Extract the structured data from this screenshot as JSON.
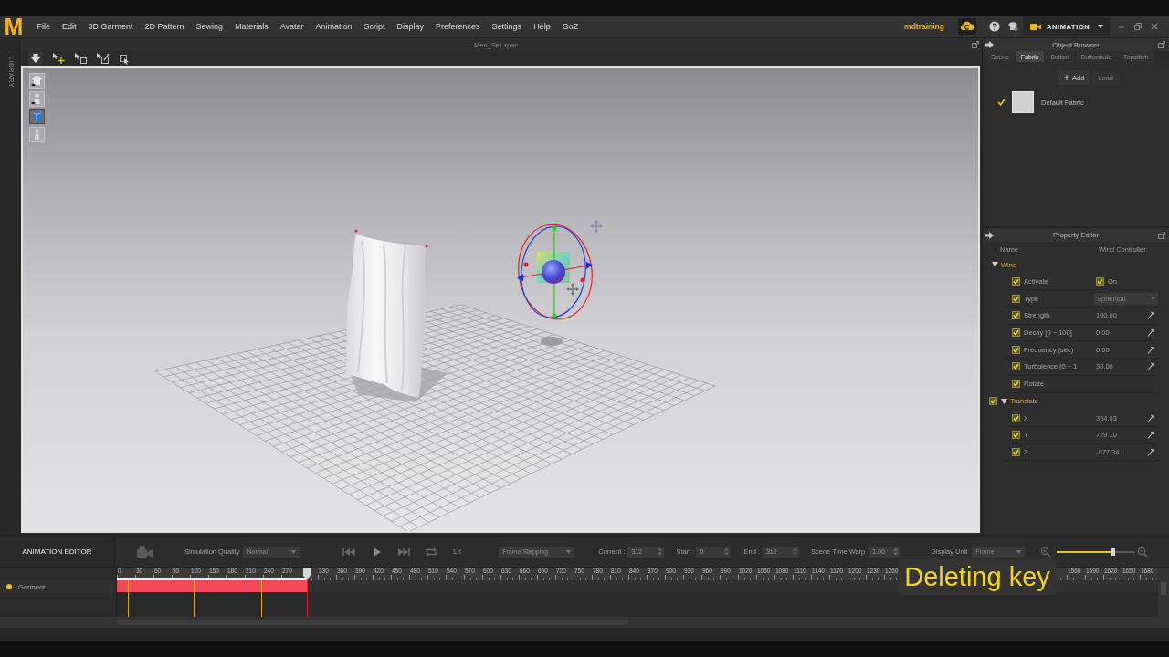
{
  "menu_bar": {
    "logo": "M",
    "items": [
      "File",
      "Edit",
      "3D Garment",
      "2D Pattern",
      "Sewing",
      "Materials",
      "Avatar",
      "Animation",
      "Script",
      "Display",
      "Preferences",
      "Settings",
      "Help",
      "GoZ"
    ],
    "user": "mdtraining",
    "mode": "ANIMATION"
  },
  "library": {
    "label": "LIBRARY"
  },
  "document": {
    "title": "Men_Set.zpac"
  },
  "viewport_tools": [
    {
      "kind": "garment",
      "selected": false
    },
    {
      "kind": "avatar",
      "selected": false
    },
    {
      "kind": "cube",
      "selected": true
    },
    {
      "kind": "figure",
      "selected": false
    }
  ],
  "object_browser": {
    "title": "Object Browser",
    "tabs": [
      {
        "label": "Scene",
        "selected": false
      },
      {
        "label": "Fabric",
        "selected": true
      },
      {
        "label": "Button",
        "selected": false
      },
      {
        "label": "Buttonhole",
        "selected": false
      },
      {
        "label": "Topstitch",
        "selected": false
      }
    ],
    "actions": [
      {
        "label": "Add",
        "disabled": false
      },
      {
        "label": "Load",
        "disabled": true
      }
    ],
    "fabrics": [
      {
        "name": "Default Fabric",
        "checked": true
      }
    ]
  },
  "property_editor": {
    "title": "Property Editor",
    "columns": [
      "Name",
      "Wind Controller"
    ],
    "groups": [
      {
        "kind": "heading",
        "label": "Wind",
        "expanded": true,
        "children": [
          {
            "kind": "toggle",
            "label": "Activate",
            "checked": true,
            "value": "On",
            "value_checked": true
          },
          {
            "kind": "dropdown",
            "label": "Type",
            "checked": true,
            "value": "Spherical"
          },
          {
            "kind": "number",
            "label": "Strength",
            "checked": true,
            "value": "100.00"
          },
          {
            "kind": "number",
            "label": "Decay [0 ~ 100]",
            "checked": true,
            "value": "0.00"
          },
          {
            "kind": "number",
            "label": "Frequency (sec)",
            "checked": true,
            "value": "0.00"
          },
          {
            "kind": "number",
            "label": "Turbulence [0 ~ 1",
            "checked": true,
            "value": "30.00"
          },
          {
            "kind": "plain",
            "label": "Rotate",
            "checked": true
          }
        ]
      },
      {
        "kind": "checkable-heading",
        "label": "Translate",
        "checked": true,
        "expanded": true,
        "children": [
          {
            "kind": "number",
            "label": "X",
            "checked": true,
            "value": "354.93"
          },
          {
            "kind": "number",
            "label": "Y",
            "checked": true,
            "value": "729.10"
          },
          {
            "kind": "number",
            "label": "Z",
            "checked": true,
            "value": "-977.34"
          }
        ]
      }
    ]
  },
  "animation_editor": {
    "title": "ANIMATION EDITOR",
    "simulation_quality": {
      "label": "Simulation Quality",
      "value": "Normal"
    },
    "speed": "1X",
    "stepping": "Frame Stepping",
    "fields": [
      {
        "label": "Current :",
        "value": "312"
      },
      {
        "label": "Start :",
        "value": "0"
      },
      {
        "label": "End :",
        "value": "312"
      },
      {
        "label": "Scene Time Warp",
        "value": "1.00"
      }
    ],
    "display_unit": {
      "label": "Display Unit",
      "value": "Frame"
    },
    "zoom": {
      "level": 0.72
    },
    "tracks": [
      {
        "name": "Garment",
        "color": "#f0c020"
      }
    ],
    "ruler": {
      "labels_before_playhead": [
        "0",
        "30",
        "60",
        "90",
        "120",
        "150",
        "180",
        "210",
        "240",
        "270"
      ],
      "labels_after_playhead": [
        "330",
        "360",
        "390",
        "420",
        "450",
        "480",
        "510",
        "540",
        "570",
        "600",
        "630",
        "660",
        "690",
        "720",
        "750",
        "780",
        "810",
        "840",
        "870",
        "900",
        "930",
        "960",
        "990",
        "1020",
        "1050",
        "1080",
        "1110",
        "1140",
        "1170",
        "1200",
        "1230",
        "1260"
      ],
      "labels_end": [
        "1560",
        "1590",
        "1620",
        "1650",
        "1680"
      ]
    },
    "clip": {
      "level": 0.1825,
      "keys": [
        {
          "level": 0.0105
        },
        {
          "level": 0.0737
        },
        {
          "level": 0.1386
        }
      ]
    }
  },
  "caption": "Deleting key"
}
